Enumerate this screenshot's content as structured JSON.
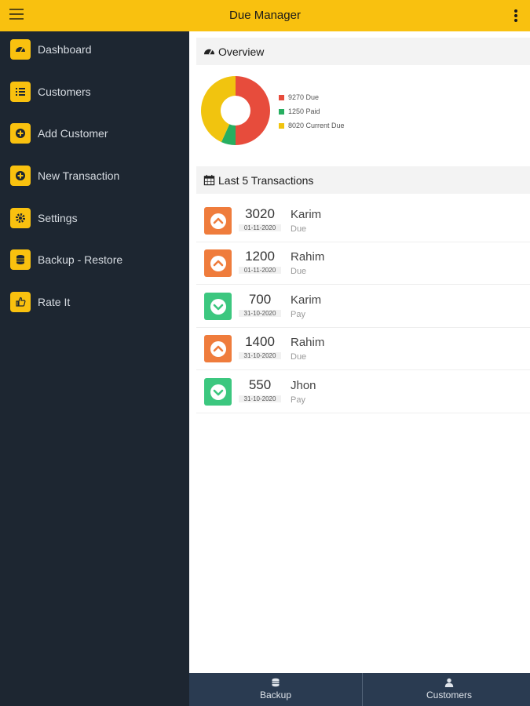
{
  "app": {
    "title": "Due Manager"
  },
  "colors": {
    "accent": "#f9c10f",
    "sidebar": "#1d2631",
    "bottom_bar": "#2a3b51",
    "due": "#e74c3c",
    "paid": "#27ae60",
    "current_due": "#f1c40f",
    "up_badge": "#ef7c3c",
    "down_badge": "#3cc77f"
  },
  "sidebar": {
    "items": [
      {
        "label": "Dashboard",
        "icon": "dashboard-gauge-icon"
      },
      {
        "label": "Customers",
        "icon": "list-icon"
      },
      {
        "label": "Add Customer",
        "icon": "plus-circle-icon"
      },
      {
        "label": "New Transaction",
        "icon": "plus-circle-icon"
      },
      {
        "label": "Settings",
        "icon": "gear-icon"
      },
      {
        "label": "Backup - Restore",
        "icon": "database-icon"
      },
      {
        "label": "Rate It",
        "icon": "thumbs-up-icon"
      }
    ]
  },
  "overview": {
    "title": "Overview",
    "legend": [
      {
        "label": "9270 Due",
        "value": 9270,
        "color": "#e74c3c"
      },
      {
        "label": "1250 Paid",
        "value": 1250,
        "color": "#27ae60"
      },
      {
        "label": "8020 Current Due",
        "value": 8020,
        "color": "#f1c40f"
      }
    ]
  },
  "transactions": {
    "title": "Last 5 Transactions",
    "items": [
      {
        "amount": "3020",
        "date": "01-11-2020",
        "name": "Karim",
        "type": "Due",
        "direction": "up"
      },
      {
        "amount": "1200",
        "date": "01-11-2020",
        "name": "Rahim",
        "type": "Due",
        "direction": "up"
      },
      {
        "amount": "700",
        "date": "31-10-2020",
        "name": "Karim",
        "type": "Pay",
        "direction": "down"
      },
      {
        "amount": "1400",
        "date": "31-10-2020",
        "name": "Rahim",
        "type": "Due",
        "direction": "up"
      },
      {
        "amount": "550",
        "date": "31-10-2020",
        "name": "Jhon",
        "type": "Pay",
        "direction": "down"
      }
    ]
  },
  "bottom_nav": {
    "backup": {
      "label": "Backup",
      "icon": "database-icon"
    },
    "customers": {
      "label": "Customers",
      "icon": "user-icon"
    }
  }
}
